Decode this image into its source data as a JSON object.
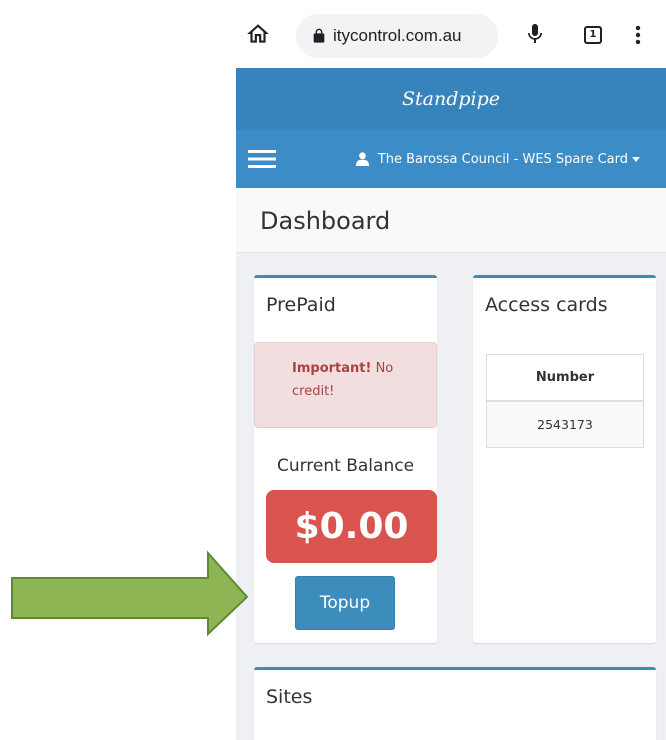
{
  "browser": {
    "url": "itycontrol.com.au",
    "tab_count": "1"
  },
  "app": {
    "title": "Standpipe",
    "user_label": "The Barossa Council - WES Spare Card"
  },
  "page": {
    "title": "Dashboard"
  },
  "prepaid": {
    "title": "PrePaid",
    "alert": {
      "strong": "Important!",
      "text": "No credit!"
    },
    "balance_label": "Current Balance",
    "balance": "$0.00",
    "topup_label": "Topup"
  },
  "access_cards": {
    "title": "Access cards",
    "columns": [
      "Number"
    ],
    "rows": [
      [
        "2543173"
      ]
    ]
  },
  "sites": {
    "title": "Sites"
  },
  "icons": [
    "home-icon",
    "lock-icon",
    "mic-icon",
    "tab-count-icon",
    "kebab-menu-icon",
    "hamburger-icon",
    "user-icon",
    "caret-down-icon",
    "annotation-arrow"
  ],
  "colors": {
    "header_dark": "#3784bc",
    "navbar": "#3c8dc7",
    "box_accent": "#3c8dbc",
    "alert_bg": "#f2dede",
    "alert_text": "#a94442",
    "balance_bg": "#d9534f",
    "button_bg": "#3c8dbc",
    "annotation_arrow": "#8db553"
  }
}
